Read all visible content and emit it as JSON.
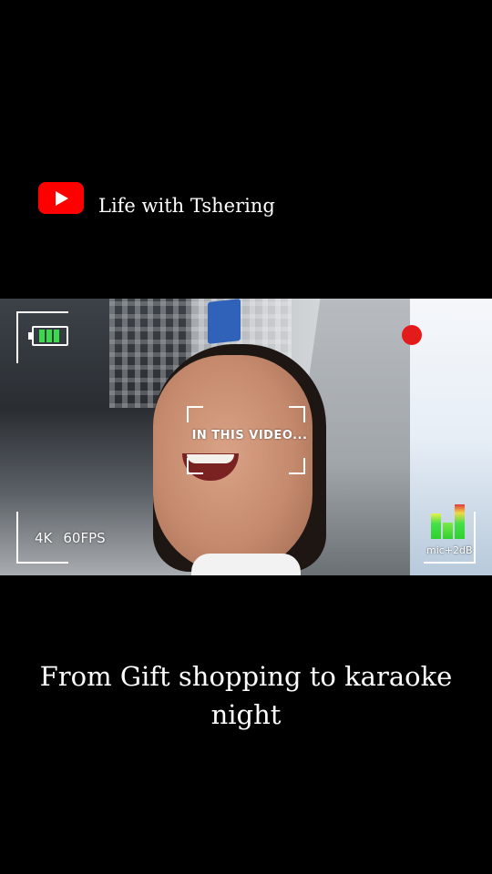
{
  "channel": {
    "name": "Life with Tshering",
    "logo_icon": "youtube-logo-icon",
    "logo_color": "#ff0000"
  },
  "video": {
    "overlay_text": "IN THIS VIDEO...",
    "resolution": "4K",
    "fps": "60FPS",
    "mic_label": "mic+2dB",
    "recording_color": "#e41b1b",
    "battery_color": "#39d94a"
  },
  "caption": {
    "line1": "From Gift shopping to karaoke",
    "line2": "night"
  }
}
